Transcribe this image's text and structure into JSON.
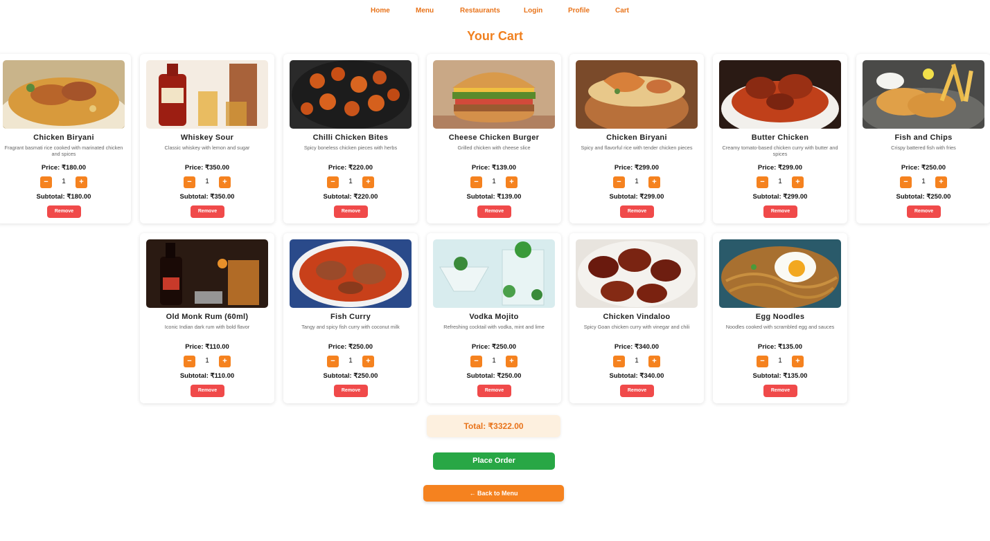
{
  "nav": {
    "items": [
      "Home",
      "Menu",
      "Restaurants",
      "Login",
      "Profile",
      "Cart"
    ]
  },
  "page_title": "Your Cart",
  "remove_label": "Remove",
  "items": [
    {
      "name": "Chicken Biryani",
      "desc": "Fragrant basmati rice cooked with marinated chicken and spices",
      "price": "Price: ₹180.00",
      "qty": "1",
      "subtotal": "Subtotal: ₹180.00"
    },
    {
      "name": "Whiskey Sour",
      "desc": "Classic whiskey with lemon and sugar",
      "price": "Price: ₹350.00",
      "qty": "1",
      "subtotal": "Subtotal: ₹350.00"
    },
    {
      "name": "Chilli Chicken Bites",
      "desc": "Spicy boneless chicken pieces with herbs",
      "price": "Price: ₹220.00",
      "qty": "1",
      "subtotal": "Subtotal: ₹220.00"
    },
    {
      "name": "Cheese Chicken Burger",
      "desc": "Grilled chicken with cheese slice",
      "price": "Price: ₹139.00",
      "qty": "1",
      "subtotal": "Subtotal: ₹139.00"
    },
    {
      "name": "Chicken Biryani",
      "desc": "Spicy and flavorful rice with tender chicken pieces",
      "price": "Price: ₹299.00",
      "qty": "1",
      "subtotal": "Subtotal: ₹299.00"
    },
    {
      "name": "Butter Chicken",
      "desc": "Creamy tomato-based chicken curry with butter and spices",
      "price": "Price: ₹299.00",
      "qty": "1",
      "subtotal": "Subtotal: ₹299.00"
    },
    {
      "name": "Fish and Chips",
      "desc": "Crispy battered fish with fries",
      "price": "Price: ₹250.00",
      "qty": "1",
      "subtotal": "Subtotal: ₹250.00"
    },
    {
      "name": "Old Monk Rum (60ml)",
      "desc": "Iconic Indian dark rum with bold flavor",
      "price": "Price: ₹110.00",
      "qty": "1",
      "subtotal": "Subtotal: ₹110.00"
    },
    {
      "name": "Fish Curry",
      "desc": "Tangy and spicy fish curry with coconut milk",
      "price": "Price: ₹250.00",
      "qty": "1",
      "subtotal": "Subtotal: ₹250.00"
    },
    {
      "name": "Vodka Mojito",
      "desc": "Refreshing cocktail with vodka, mint and lime",
      "price": "Price: ₹250.00",
      "qty": "1",
      "subtotal": "Subtotal: ₹250.00"
    },
    {
      "name": "Chicken Vindaloo",
      "desc": "Spicy Goan chicken curry with vinegar and chili",
      "price": "Price: ₹340.00",
      "qty": "1",
      "subtotal": "Subtotal: ₹340.00"
    },
    {
      "name": "Egg Noodles",
      "desc": "Noodles cooked with scrambled egg and sauces",
      "price": "Price: ₹135.00",
      "qty": "1",
      "subtotal": "Subtotal: ₹135.00"
    }
  ],
  "total": "Total: ₹3322.00",
  "place_order": "Place Order",
  "back_to_menu": "← Back to Menu",
  "colors": {
    "accent": "#f5821f",
    "remove": "#f04a4a",
    "place_order": "#28a745",
    "total_bg": "#fdf0df"
  }
}
